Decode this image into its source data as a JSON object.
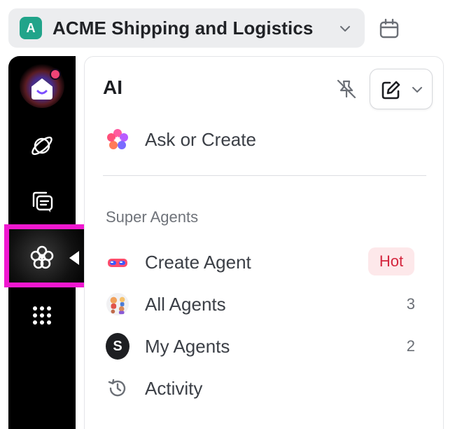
{
  "workspace": {
    "avatar_letter": "A",
    "name": "ACME Shipping and Logistics"
  },
  "sidebar": {
    "items": [
      {
        "name": "home",
        "icon": "home-icon",
        "has_notification": true
      },
      {
        "name": "planner",
        "icon": "planet-icon"
      },
      {
        "name": "chat",
        "icon": "chat-icon"
      },
      {
        "name": "ai",
        "icon": "ai-flower-icon",
        "active": true
      },
      {
        "name": "more",
        "icon": "grid-dots-icon"
      }
    ]
  },
  "panel": {
    "title": "AI",
    "ask_label": "Ask or Create",
    "section_title": "Super Agents",
    "items": [
      {
        "label": "Create Agent",
        "badge": "Hot",
        "icon": "agent-mask-icon"
      },
      {
        "label": "All Agents",
        "count": "3",
        "icon": "agents-group-icon"
      },
      {
        "label": "My Agents",
        "count": "2",
        "avatar_letter": "S"
      },
      {
        "label": "Activity",
        "icon": "history-icon"
      }
    ]
  },
  "colors": {
    "workspace_avatar": "#21a48a",
    "highlight": "#f018d0",
    "hot_badge_bg": "#fde8ea",
    "hot_badge_text": "#d4253d",
    "notification": "#ef4476"
  }
}
